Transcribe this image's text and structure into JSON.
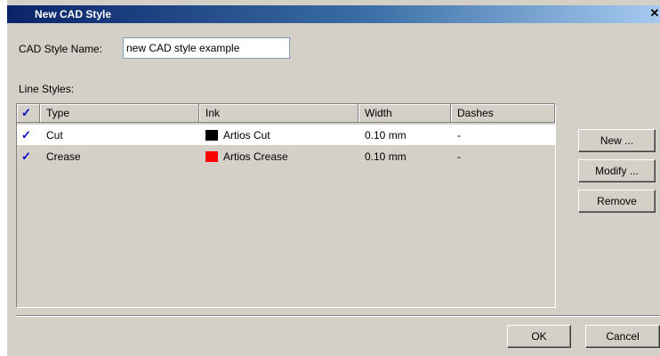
{
  "window": {
    "title": "New CAD Style",
    "close_glyph": "✕"
  },
  "form": {
    "name_label": "CAD Style Name:",
    "name_value": "new CAD style example",
    "line_styles_label": "Line Styles:"
  },
  "table": {
    "header_check": "✓",
    "columns": [
      "Type",
      "Ink",
      "Width",
      "Dashes"
    ],
    "rows": [
      {
        "checked": "✓",
        "type": "Cut",
        "ink": "Artios Cut",
        "ink_color": "#000000",
        "width": "0.10 mm",
        "dashes": "-",
        "selected": true
      },
      {
        "checked": "✓",
        "type": "Crease",
        "ink": "Artios Crease",
        "ink_color": "#ff0000",
        "width": "0.10 mm",
        "dashes": "-",
        "selected": false
      }
    ]
  },
  "side_buttons": {
    "new": "New ...",
    "modify": "Modify ...",
    "remove": "Remove"
  },
  "footer_buttons": {
    "ok": "OK",
    "cancel": "Cancel"
  },
  "colors": {
    "title_gradient_start": "#0a246a",
    "title_gradient_end": "#a6caf0",
    "dialog_bg": "#d4d0c8",
    "check_color": "#0000c8"
  }
}
